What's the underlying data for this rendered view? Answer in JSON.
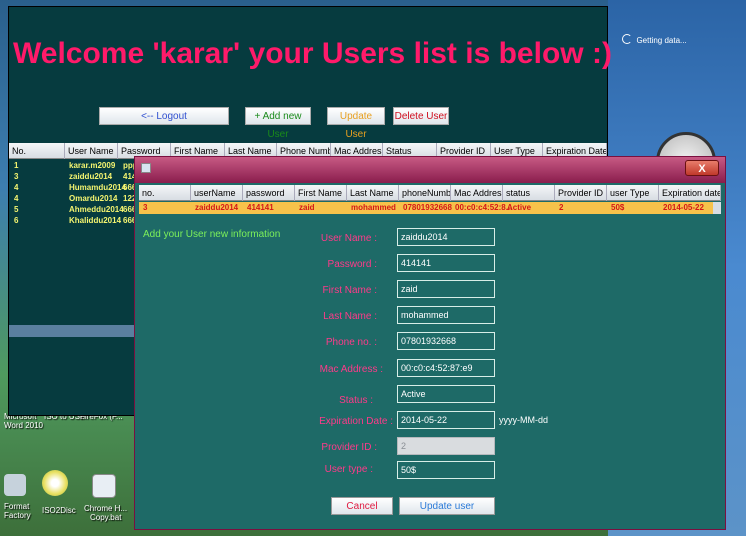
{
  "welcome": "Welcome 'karar' your Users list is below :)",
  "toolbar": {
    "logout": "<-- Logout",
    "add": "+ Add new User",
    "update": "Update User",
    "delete": "Delete User"
  },
  "main_table": {
    "headers": [
      "No.",
      "User Name",
      "Password",
      "First Name",
      "Last Name",
      "Phone Number",
      "Mac Address",
      "Status",
      "Provider ID",
      "User Type",
      "Expiration Date"
    ],
    "rows": [
      {
        "no": "1",
        "user": "karar.m2009",
        "pass": "ppp"
      },
      {
        "no": "3",
        "user": "zaiddu2014",
        "pass": "414"
      },
      {
        "no": "4",
        "user": "Humamdu2014",
        "pass": "666"
      },
      {
        "no": "4",
        "user": "Omardu2014",
        "pass": "122"
      },
      {
        "no": "5",
        "user": "Ahmeddu2014",
        "pass": "666"
      },
      {
        "no": "6",
        "user": "Khaliddu2014",
        "pass": "666"
      }
    ]
  },
  "gadget": {
    "status": "Getting data..."
  },
  "desktop_icons": [
    {
      "label": "Microsoft",
      "label2": "Word 2010"
    },
    {
      "label": "ISO to USB",
      "label2": ""
    },
    {
      "label": "FireFox (F...",
      "label2": ""
    },
    {
      "label": "Format",
      "label2": "Factory"
    },
    {
      "label": "ISO2Disc",
      "label2": ""
    },
    {
      "label": "Chrome H...",
      "label2": "Copy.bat"
    }
  ],
  "dialog": {
    "close": "X",
    "table": {
      "headers": [
        "no.",
        "userName",
        "password",
        "First Name",
        "Last Name",
        "phoneNumber",
        "Mac Address",
        "status",
        "Provider ID",
        "user Type",
        "Expiration date"
      ],
      "row": [
        "3",
        "zaiddu2014",
        "414141",
        "zaid",
        "mohammed",
        "07801932668",
        "00:c0:c4:52:8...",
        "Active",
        "2",
        "50$",
        "2014-05-22"
      ]
    },
    "form_title": "Add your User new information",
    "fields": [
      {
        "label": "User Name :",
        "value": "zaiddu2014"
      },
      {
        "label": "Password :",
        "value": "414141"
      },
      {
        "label": "First Name :",
        "value": "zaid"
      },
      {
        "label": "Last Name :",
        "value": "mohammed"
      },
      {
        "label": "Phone no. :",
        "value": "07801932668"
      },
      {
        "label": "Mac Address :",
        "value": "00:c0:c4:52:87:e9"
      },
      {
        "label": "Status :",
        "value": "Active"
      },
      {
        "label": "Expiration Date :",
        "value": "2014-05-22"
      },
      {
        "label": "Provider ID :",
        "value": "2"
      },
      {
        "label": "User type :",
        "value": "50$"
      }
    ],
    "date_hint": "yyyy-MM-dd",
    "cancel": "Cancel",
    "update": "Update user"
  }
}
